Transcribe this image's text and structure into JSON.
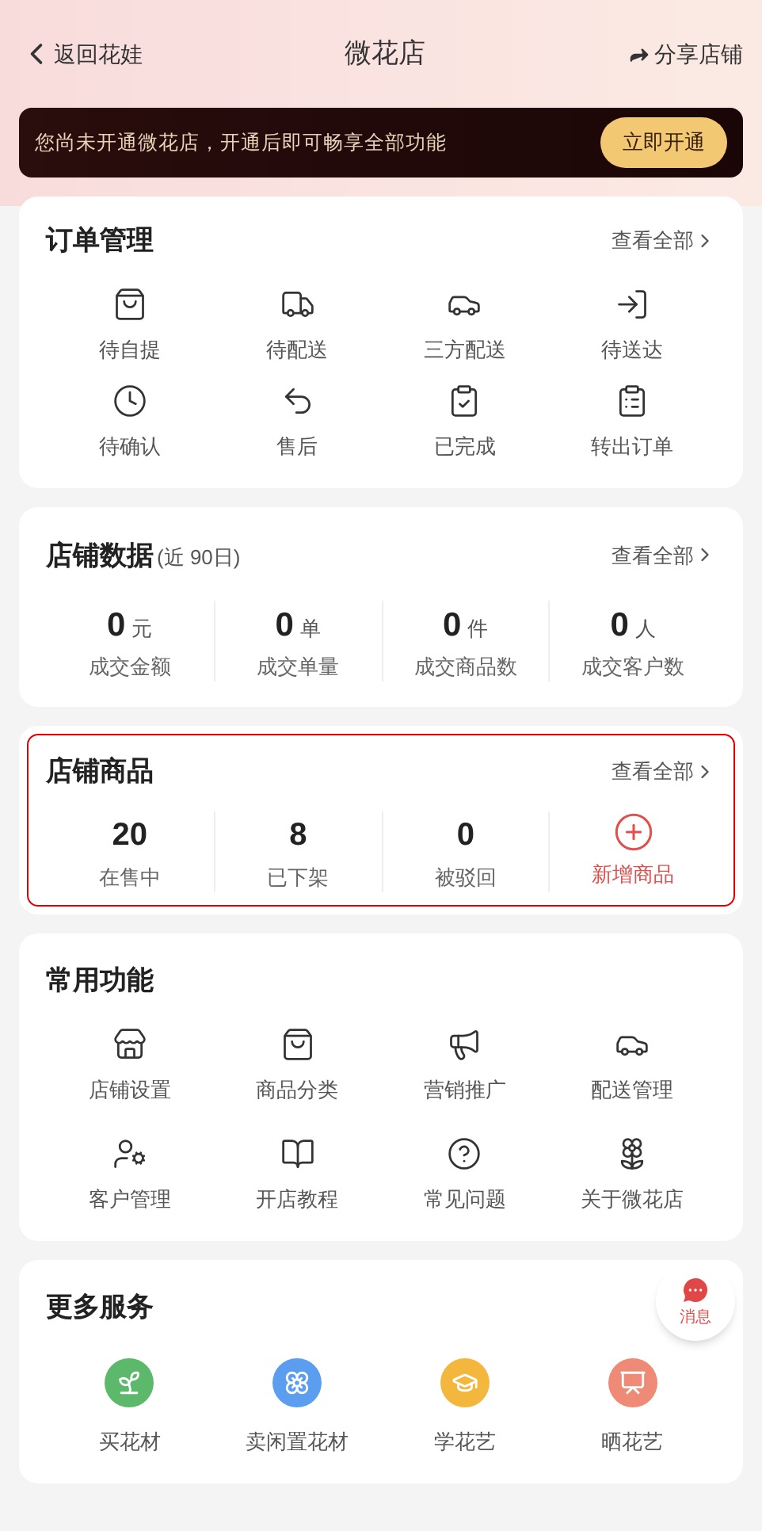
{
  "header": {
    "back_label": "返回花娃",
    "title": "微花店",
    "share_label": "分享店铺"
  },
  "banner": {
    "text": "您尚未开通微花店，开通后即可畅享全部功能",
    "button": "立即开通"
  },
  "orders": {
    "title": "订单管理",
    "view_all": "查看全部",
    "items": [
      "待自提",
      "待配送",
      "三方配送",
      "待送达",
      "待确认",
      "售后",
      "已完成",
      "转出订单"
    ]
  },
  "stats": {
    "title": "店铺数据",
    "subtitle": "(近 90日)",
    "view_all": "查看全部",
    "items": [
      {
        "value": "0",
        "unit": "元",
        "label": "成交金额"
      },
      {
        "value": "0",
        "unit": "单",
        "label": "成交单量"
      },
      {
        "value": "0",
        "unit": "件",
        "label": "成交商品数"
      },
      {
        "value": "0",
        "unit": "人",
        "label": "成交客户数"
      }
    ]
  },
  "products": {
    "title": "店铺商品",
    "view_all": "查看全部",
    "highlighted": true,
    "items": [
      {
        "kind": "count",
        "value": "20",
        "label": "在售中"
      },
      {
        "kind": "count",
        "value": "8",
        "label": "已下架"
      },
      {
        "kind": "count",
        "value": "0",
        "label": "被驳回"
      },
      {
        "kind": "action",
        "label": "新增商品"
      }
    ]
  },
  "functions": {
    "title": "常用功能",
    "items": [
      "店铺设置",
      "商品分类",
      "营销推广",
      "配送管理",
      "客户管理",
      "开店教程",
      "常见问题",
      "关于微花店"
    ]
  },
  "more_services": {
    "title": "更多服务",
    "items": [
      {
        "label": "买花材",
        "color": "#5cb86a"
      },
      {
        "label": "卖闲置花材",
        "color": "#5b9ef0"
      },
      {
        "label": "学花艺",
        "color": "#f3b73e"
      },
      {
        "label": "晒花艺",
        "color": "#ef8a76"
      }
    ]
  },
  "float_button": {
    "label": "消息"
  }
}
